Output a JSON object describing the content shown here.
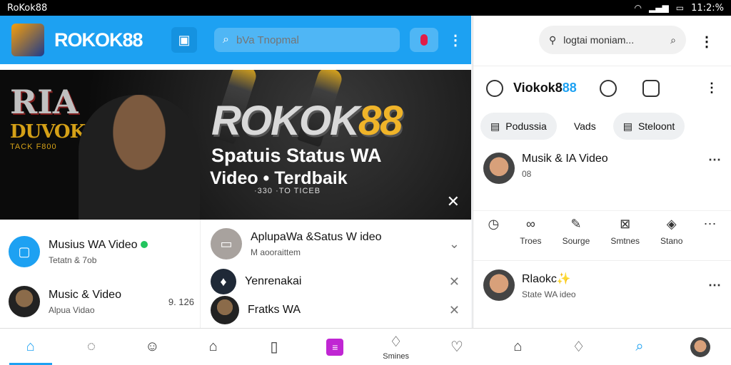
{
  "status_bar": {
    "app_name": "RoKok88",
    "time": "11:2:%"
  },
  "left": {
    "brand": "ROKOK88",
    "search": {
      "placeholder": "bVa Tnopmal"
    },
    "banner": {
      "logo_mark": "RIA",
      "logo_sub": "DUVOKS",
      "logo_sub2": "TACK F800",
      "brand_a": "ROKOK",
      "brand_b": "88",
      "line1": "Spatuis Status WA",
      "line2": "Video • Terdbaik",
      "line3": "·330 ·TO TICEB"
    },
    "list_left": [
      {
        "title": "Musius WA Video",
        "sub": "Tetatn & 7ob",
        "meta": ""
      },
      {
        "title": "Music & Video",
        "sub": "Alpua Vidao",
        "meta": "9. 126"
      }
    ],
    "list_right": [
      {
        "title": "AplupaWa &Satus W ideo",
        "sub": "M aooraittem"
      },
      {
        "title": "Yenrenakai",
        "sub": ""
      },
      {
        "title": "Fratks WA",
        "sub": ""
      }
    ]
  },
  "bottom_nav": [
    {
      "icon": "home-icon",
      "label": ""
    },
    {
      "icon": "chat-icon",
      "label": ""
    },
    {
      "icon": "smile-icon",
      "label": ""
    },
    {
      "icon": "house-icon",
      "label": ""
    },
    {
      "icon": "book-icon",
      "label": ""
    },
    {
      "icon": "grid-icon",
      "label": ""
    },
    {
      "icon": "bell-icon",
      "label": "Smines"
    },
    {
      "icon": "heart-icon",
      "label": ""
    },
    {
      "icon": "home2-icon",
      "label": ""
    },
    {
      "icon": "bell2-icon",
      "label": ""
    },
    {
      "icon": "search-icon",
      "label": ""
    },
    {
      "icon": "avatar-icon",
      "label": ""
    }
  ],
  "right": {
    "search": {
      "value": "logtai moniam..."
    },
    "brand_a": "Viokok8",
    "brand_b": "88",
    "chips": [
      {
        "label": "Podussia"
      },
      {
        "label": "Vads"
      },
      {
        "label": "Steloont"
      }
    ],
    "card1": {
      "title": "Musik & IA Video",
      "sub": "08"
    },
    "actions": [
      {
        "label": ""
      },
      {
        "label": "Troes"
      },
      {
        "label": "Sourge"
      },
      {
        "label": "Smtnes"
      },
      {
        "label": "Stano"
      }
    ],
    "card2": {
      "title": "Rlaokc✨",
      "sub": "State WA ideo"
    }
  },
  "colors": {
    "accent": "#1da1f2",
    "gold": "#f0b429",
    "purple": "#c026d3"
  }
}
